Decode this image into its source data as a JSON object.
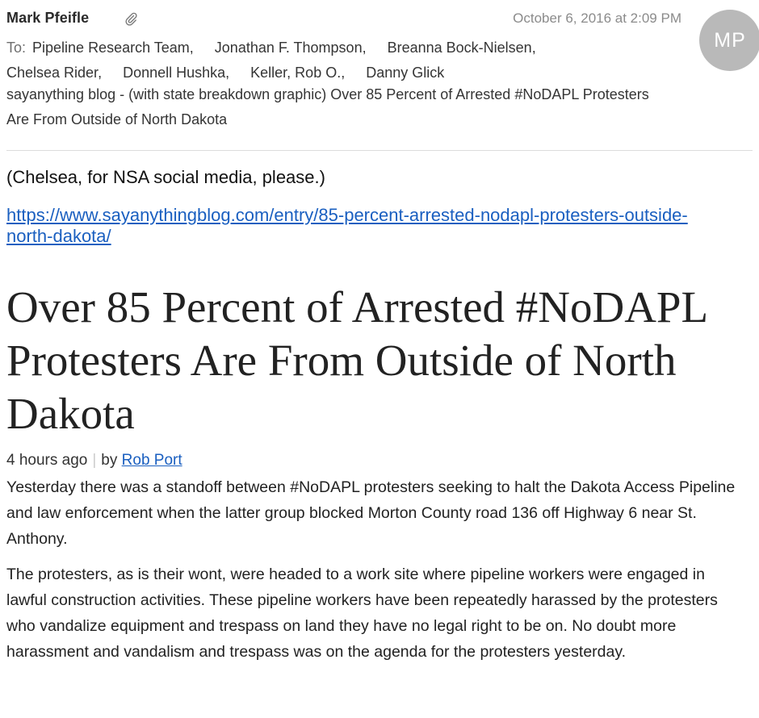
{
  "email": {
    "sender": "Mark Pfeifle",
    "date": "October 6, 2016 at 2:09 PM",
    "avatar_initials": "MP",
    "to_label": "To:",
    "recipients": [
      "Pipeline Research Team,",
      "Jonathan F. Thompson,",
      "Breanna Bock-Nielsen,",
      "Chelsea Rider,",
      "Donnell Hushka,",
      "Keller, Rob O.,",
      "Danny Glick"
    ],
    "subject": "sayanything blog - (with state breakdown graphic) Over 85 Percent of Arrested #NoDAPL Protesters Are From Outside of North Dakota",
    "attachment_icon": "paperclip-icon"
  },
  "body": {
    "note": "(Chelsea, for NSA social media, please.)",
    "link": "https://www.sayanythingblog.com/entry/85-percent-arrested-nodapl-protesters-outside-north-dakota/"
  },
  "article": {
    "title": "Over 85 Percent of Arrested #NoDAPL Protesters Are From Outside of North Dakota",
    "time_ago": "4 hours ago",
    "by_label": "by",
    "author": "Rob Port",
    "paragraphs": [
      "Yesterday there was a standoff between #NoDAPL protesters seeking to halt the Dakota Access Pipeline and law enforcement when the latter group blocked Morton County road 136 off Highway 6 near St. Anthony.",
      "The protesters, as is their wont, were headed to a work site where pipeline workers were engaged in lawful construction activities. These pipeline workers have been repeatedly harassed by the protesters who vandalize equipment and trespass on land they have no legal right to be on. No doubt more harassment and vandalism and trespass was on the agenda for the protesters yesterday."
    ]
  },
  "colors": {
    "link": "#1a5fc0",
    "avatar_bg": "#b9b9b9",
    "date": "#8b8b8b",
    "divider": "#dcdcdc"
  }
}
